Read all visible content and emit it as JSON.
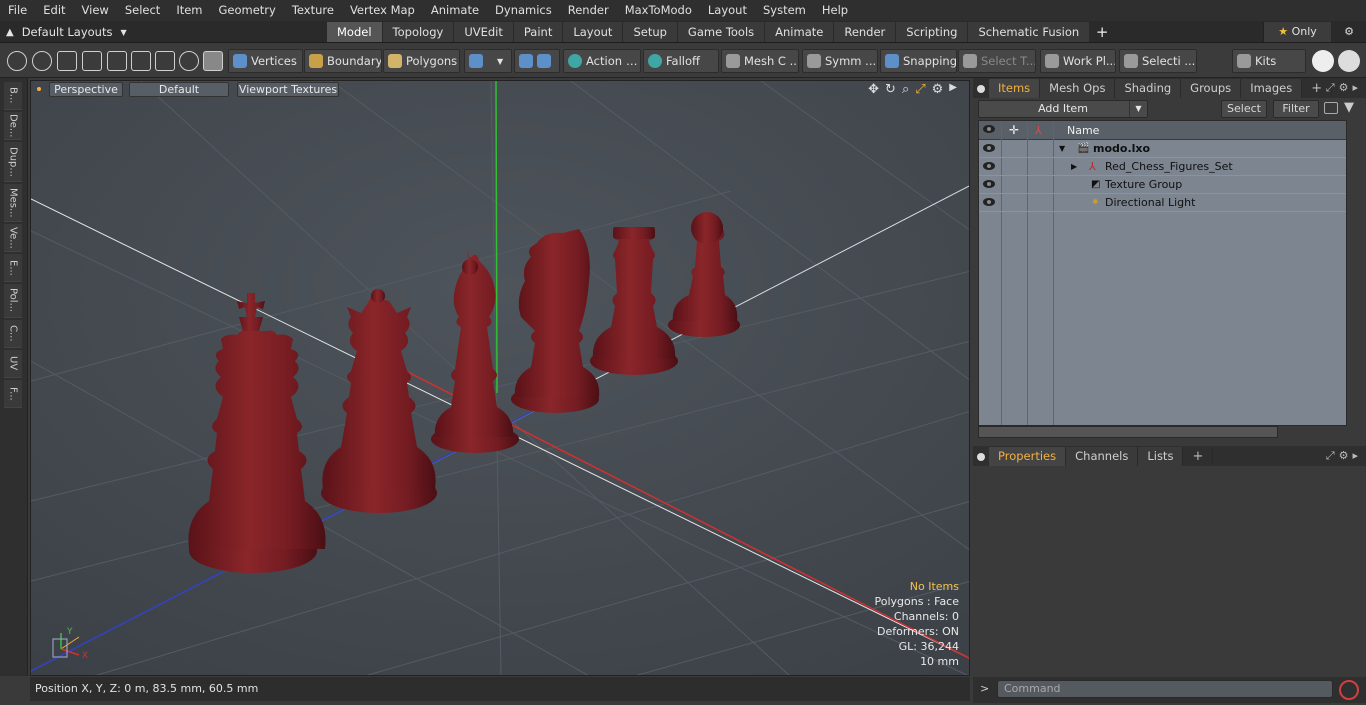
{
  "menu": [
    "File",
    "Edit",
    "View",
    "Select",
    "Item",
    "Geometry",
    "Texture",
    "Vertex Map",
    "Animate",
    "Dynamics",
    "Render",
    "MaxToModo",
    "Layout",
    "System",
    "Help"
  ],
  "layout_dropdown": "Default Layouts",
  "tabs": [
    "Model",
    "Topology",
    "UVEdit",
    "Paint",
    "Layout",
    "Setup",
    "Game Tools",
    "Animate",
    "Render",
    "Scripting",
    "Schematic Fusion"
  ],
  "only_label": "Only",
  "toolbar": {
    "vertices": "Vertices",
    "boundary": "Boundary",
    "polygons": "Polygons",
    "action": "Action",
    "falloff": "Falloff",
    "mesh": "Mesh C ...",
    "symm": "Symm ...",
    "snapping": "Snapping",
    "select_t": "Select T...",
    "work_pl": "Work Pl...",
    "selecti": "Selecti ...",
    "kits": "Kits"
  },
  "left_tabs": [
    "B...",
    "De...",
    "Dup...",
    "Mes...",
    "Ve...",
    "E...",
    "Pol...",
    "C...",
    "UV",
    "F..."
  ],
  "viewport": {
    "view_mode": "Perspective",
    "shading": "Default",
    "textures": "Viewport Textures",
    "info": {
      "selection": "No Items",
      "polygons": "Polygons : Face",
      "channels": "Channels: 0",
      "deformers": "Deformers: ON",
      "gl": "GL: 36,244",
      "grid": "10 mm"
    },
    "axis_y": "Y",
    "axis_x": "X"
  },
  "status": "Position X, Y, Z:   0 m, 83.5 mm, 60.5 mm",
  "items_panel": {
    "tabs": [
      "Items",
      "Mesh Ops",
      "Shading",
      "Groups",
      "Images"
    ],
    "add_item": "Add Item",
    "select": "Select",
    "filter": "Filter",
    "column_name": "Name",
    "rows": [
      {
        "label": "modo.lxo",
        "bold": true
      },
      {
        "label": "Red_Chess_Figures_Set",
        "bold": false
      },
      {
        "label": "Texture Group",
        "bold": false
      },
      {
        "label": "Directional Light",
        "bold": false
      }
    ]
  },
  "properties_panel": {
    "tabs": [
      "Properties",
      "Channels",
      "Lists"
    ]
  },
  "command": {
    "placeholder": "Command"
  },
  "colors": {
    "accent": "#f4b13d",
    "piece": "#7a1e22",
    "viewport_bg": "#474c52",
    "axis_x": "#d03030",
    "axis_y": "#30c030",
    "axis_z": "#3040c0"
  }
}
